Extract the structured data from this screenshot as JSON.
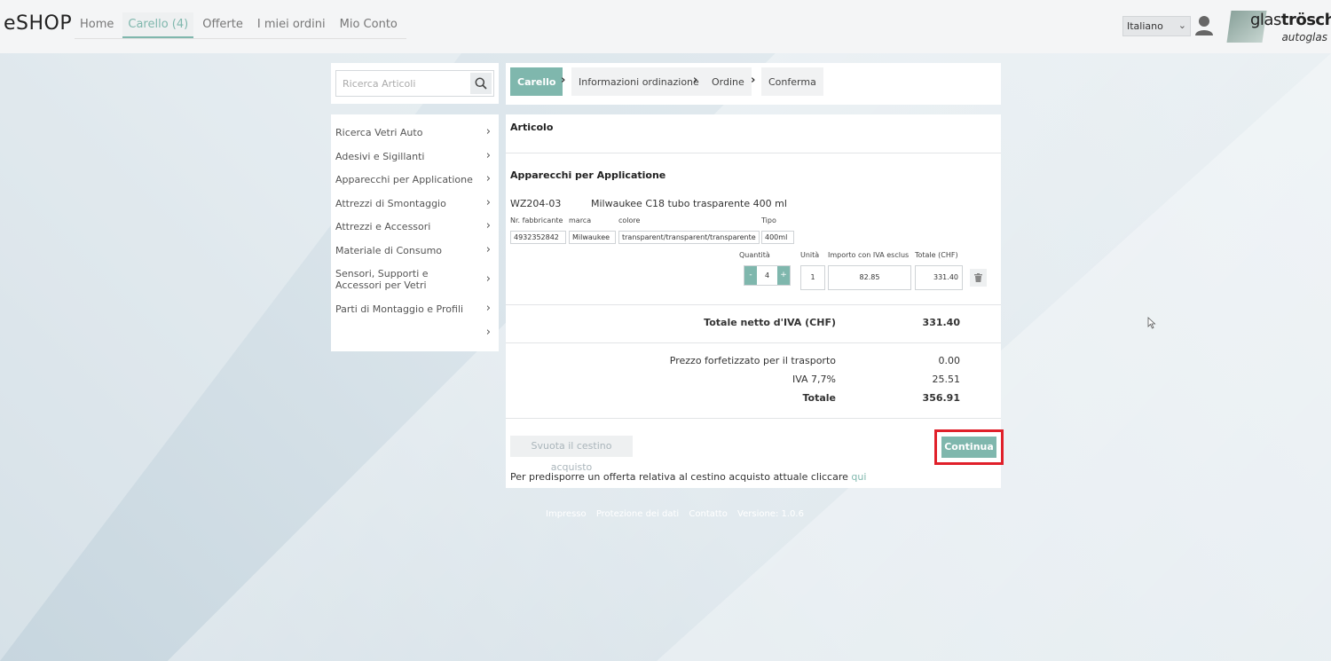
{
  "header": {
    "brand": "eSHOP",
    "nav": [
      "Home",
      "Carello (4)",
      "Offerte",
      "I miei ordini",
      "Mio Conto"
    ],
    "language": "Italiano",
    "logo_main": "glas",
    "logo_bold": "tröschl",
    "logo_sub": "autoglas"
  },
  "search": {
    "placeholder": "Ricerca Articoli"
  },
  "categories": [
    "Ricerca Vetri Auto",
    "Adesivi e Sigillanti",
    "Apparecchi per Applicatione",
    "Attrezzi di Smontaggio",
    "Attrezzi e Accessori",
    "Materiale di Consumo",
    "Sensori, Supporti e Accessori per Vetri",
    "Parti di Montaggio e Profili",
    ""
  ],
  "steps": [
    "Carello",
    "Informazioni ordinazione",
    "Ordine",
    "Conferma"
  ],
  "cart": {
    "header": "Articolo",
    "group": "Apparecchi per Applicatione",
    "item": {
      "code": "WZ204-03",
      "name": "Milwaukee C18 tubo trasparente 400 ml",
      "labels": {
        "manufacturer_no": "Nr. fabbricante",
        "brand": "marca",
        "color": "colore",
        "type": "Tipo"
      },
      "manufacturer_no": "4932352842",
      "brand": "Milwaukee",
      "color": "transparent/transparent/transparente",
      "type": "400ml",
      "qty_label": "Quantità",
      "unit_label": "Unità",
      "price_label": "Importo con IVA esclus",
      "total_label": "Totale (CHF)",
      "qty": "4",
      "minus": "-",
      "plus": "+",
      "unit": "1",
      "price": "82.85",
      "total": "331.40"
    },
    "net_label": "Totale netto d'IVA (CHF)",
    "net_value": "331.40",
    "shipping_label": "Prezzo forfetizzato per il trasporto",
    "shipping_value": "0.00",
    "vat_label": "IVA 7,7%",
    "vat_value": "25.51",
    "total_label": "Totale",
    "total_value": "356.91",
    "empty_button": "Svuota il cestino acquisto",
    "continue_button": "Continua",
    "offer_text": "Per predisporre un offerta relativa al cestino acquisto attuale cliccare",
    "offer_link": "qui"
  },
  "footer": [
    "Impresso",
    "Protezione dei dati",
    "Contatto",
    "Versione: 1.0.6"
  ],
  "colors": {
    "accent": "#7fb7ad",
    "highlight": "#e0202a"
  }
}
